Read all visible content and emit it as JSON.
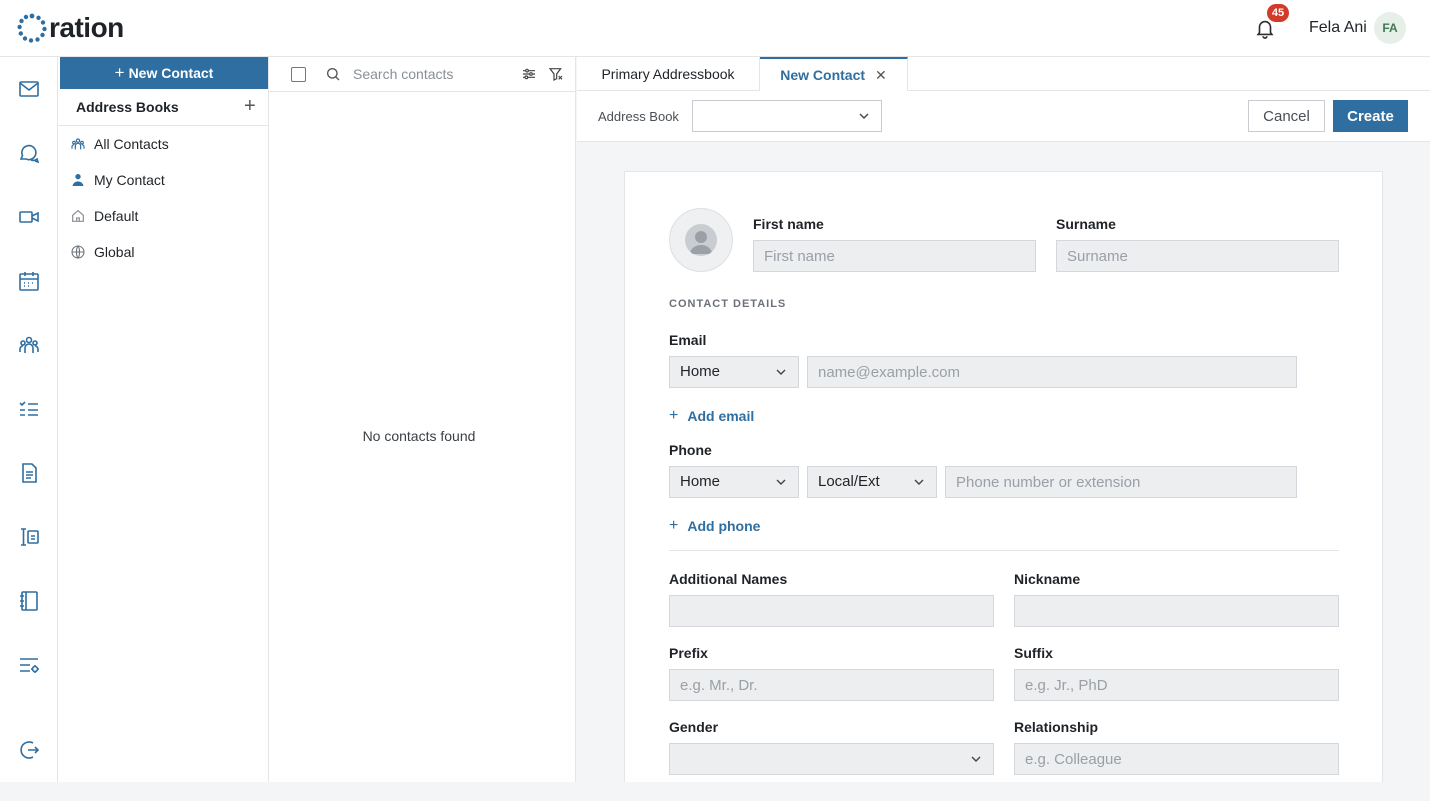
{
  "app": {
    "logo_text": "ration",
    "notifications_count": "45",
    "user_name": "Fela Ani",
    "user_initials": "FA"
  },
  "rail": {
    "items": [
      "mail-icon",
      "chat-icon",
      "video-icon",
      "calendar-icon",
      "contacts-icon",
      "tasks-icon",
      "document-icon",
      "forms-icon",
      "notebook-icon",
      "settings-list-icon",
      "logout-icon"
    ]
  },
  "addressbooks": {
    "new_contact_label": "New Contact",
    "title": "Address Books",
    "items": [
      {
        "label": "All Contacts",
        "icon": "people-icon"
      },
      {
        "label": "My Contact",
        "icon": "person-icon"
      },
      {
        "label": "Default",
        "icon": "home-icon"
      },
      {
        "label": "Global",
        "icon": "globe-icon"
      }
    ]
  },
  "contact_list": {
    "search_placeholder": "Search contacts",
    "empty_message": "No contacts found"
  },
  "tabs": [
    {
      "label": "Primary Addressbook",
      "active": false
    },
    {
      "label": "New Contact",
      "active": true,
      "closable": true
    }
  ],
  "formbar": {
    "address_book_label": "Address Book",
    "address_book_value": "",
    "cancel_label": "Cancel",
    "create_label": "Create"
  },
  "form": {
    "first_name_label": "First name",
    "first_name_placeholder": "First name",
    "surname_label": "Surname",
    "surname_placeholder": "Surname",
    "section_contact_details": "CONTACT DETAILS",
    "email_label": "Email",
    "email_type": "Home",
    "email_placeholder": "name@example.com",
    "add_email_label": "Add email",
    "phone_label": "Phone",
    "phone_type": "Home",
    "phone_kind": "Local/Ext",
    "phone_placeholder": "Phone number or extension",
    "add_phone_label": "Add phone",
    "additional_names_label": "Additional Names",
    "nickname_label": "Nickname",
    "prefix_label": "Prefix",
    "prefix_placeholder": "e.g. Mr., Dr.",
    "suffix_label": "Suffix",
    "suffix_placeholder": "e.g. Jr., PhD",
    "gender_label": "Gender",
    "gender_value": "",
    "relationship_label": "Relationship",
    "relationship_placeholder": "e.g. Colleague"
  },
  "colors": {
    "accent": "#2f6ea0",
    "badge": "#d23a2a",
    "avatar_bg": "#e6efe8"
  }
}
